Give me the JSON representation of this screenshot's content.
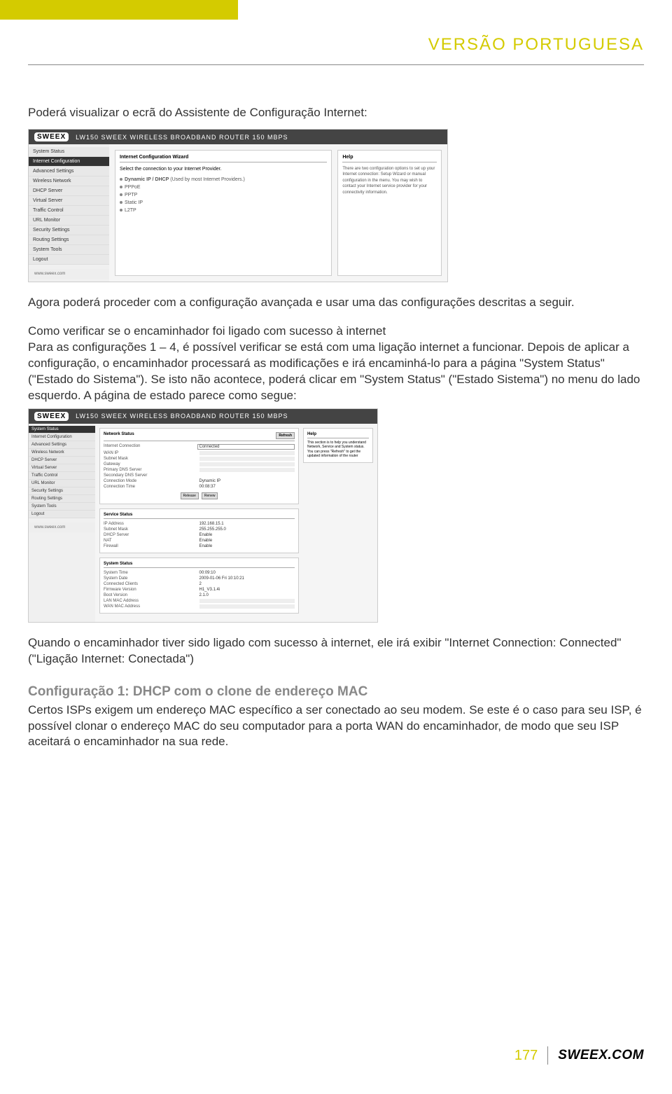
{
  "header": {
    "language": "VERSÃO PORTUGUESA"
  },
  "intro_text": "Poderá visualizar o ecrã do Assistente de Configuração Internet:",
  "screenshot1": {
    "logo": "SWEEX",
    "title": "LW150 SWEEX WIRELESS BROADBAND ROUTER 150 MBPS",
    "nav": {
      "system_status": "System Status",
      "internet_config": "Internet Configuration",
      "advanced_settings": "Advanced Settings",
      "wireless_network": "Wireless Network",
      "dhcp_server": "DHCP Server",
      "virtual_server": "Virtual Server",
      "traffic_control": "Traffic Control",
      "url_monitor": "URL Monitor",
      "security_settings": "Security Settings",
      "routing_settings": "Routing Settings",
      "system_tools": "System Tools",
      "logout": "Logout"
    },
    "footer_link": "www.sweex.com",
    "wizard": {
      "title": "Internet Configuration Wizard",
      "instruction": "Select the connection to your Internet Provider.",
      "options": {
        "dhcp": "Dynamic IP / DHCP",
        "dhcp_note": "(Used by most Internet Providers.)",
        "pppoe": "PPPoE",
        "pptp": "PPTP",
        "static": "Static IP",
        "l2tp": "L2TP"
      }
    },
    "help": {
      "title": "Help",
      "text": "There are two configuration options to set up your Internet connection: Setup Wizard or manual configuration in the menu. You may wish to contact your Internet service provider for your connectivity information."
    }
  },
  "para1": "Agora poderá proceder com a configuração avançada e usar uma das configurações descritas a seguir.",
  "para2_lead": "Como verificar se o encaminhador foi ligado com sucesso à internet",
  "para2_body": "Para as configurações 1 – 4, é possível verificar se está com uma ligação internet a funcionar. Depois de aplicar a configuração, o encaminhador processará as modificações e irá encaminhá-lo para a página \"System Status\" (\"Estado do Sistema\"). Se isto não acontece, poderá clicar em \"System Status\" (\"Estado Sistema\") no menu do lado esquerdo. A página de estado parece como segue:",
  "screenshot2": {
    "logo": "SWEEX",
    "title": "LW150 SWEEX WIRELESS BROADBAND ROUTER 150 MBPS",
    "nav": {
      "system_status": "System Status",
      "internet_config": "Internet Configuration",
      "advanced_settings": "Advanced Settings",
      "wireless_network": "Wireless Network",
      "dhcp_server": "DHCP Server",
      "virtual_server": "Virtual Server",
      "traffic_control": "Traffic Control",
      "url_monitor": "URL Monitor",
      "security_settings": "Security Settings",
      "routing_settings": "Routing Settings",
      "system_tools": "System Tools",
      "logout": "Logout"
    },
    "footer_link": "www.sweex.com",
    "help": {
      "title": "Help",
      "text": "This section is to help you understand Network, Service and System status. You can press \"Refresh\" to get the updated information of the router"
    },
    "network_status": {
      "title": "Network Status",
      "refresh_btn": "Refresh",
      "rows": {
        "internet_connection_label": "Internet Connection",
        "internet_connection_value": "Connected",
        "wan_ip_label": "WAN IP",
        "subnet_mask_label": "Subnet Mask",
        "gateway_label": "Gateway",
        "dns_label": "Primary DNS Server",
        "secondary_dns_label": "Secondary DNS Server",
        "connection_mode_label": "Connection Mode",
        "connection_mode_value": "Dynamic IP",
        "connection_time_label": "Connection Time",
        "connection_time_value": "00:08:37",
        "release_btn": "Release",
        "renew_btn": "Renew"
      }
    },
    "service_status": {
      "title": "Service Status",
      "rows": {
        "ip_address_label": "IP Address",
        "ip_address_value": "192.168.15.1",
        "subnet_mask_label": "Subnet Mask",
        "subnet_mask_value": "255.255.255.0",
        "dhcp_server_label": "DHCP Server",
        "dhcp_server_value": "Enable",
        "nat_label": "NAT",
        "nat_value": "Enable",
        "firewall_label": "Firewall",
        "firewall_value": "Enable"
      }
    },
    "system_status": {
      "title": "System Status",
      "rows": {
        "system_time_label": "System Time",
        "system_time_value": "00:09:10",
        "system_date_label": "System Date",
        "system_date_value": "2009-01-06 Fri 10:10:21",
        "connected_clients_label": "Connected Clients",
        "connected_clients_value": "2",
        "firmware_version_label": "Firmware Version",
        "firmware_version_value": "H1_V3.1.4i",
        "boot_version_label": "Boot Version",
        "boot_version_value": "2.1.0",
        "lan_mac_label": "LAN MAC Address",
        "wan_mac_label": "WAN MAC Address"
      }
    }
  },
  "para3": "Quando o encaminhador tiver sido ligado com sucesso à internet, ele irá exibir \"Internet Connection: Connected\" (\"Ligação Internet: Conectada\")",
  "config1": {
    "heading": "Configuração 1: DHCP com o clone de endereço MAC",
    "body": "Certos ISPs exigem um endereço MAC específico a ser conectado ao seu modem. Se este é o caso para seu ISP, é possível clonar o endereço MAC do seu computador para a porta WAN do encaminhador, de modo que seu ISP aceitará o encaminhador na sua rede."
  },
  "footer": {
    "page": "177",
    "brand": "SWEEX.COM"
  }
}
